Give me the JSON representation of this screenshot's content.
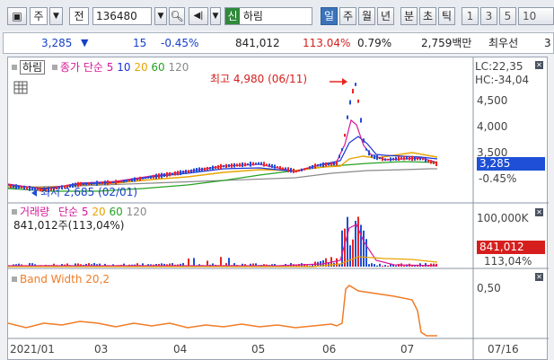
{
  "toolbar": {
    "market": "주",
    "prefix": "전",
    "code": "136480",
    "tag": "신",
    "name": "하림",
    "periods": [
      "일",
      "주",
      "월",
      "년",
      "분",
      "초",
      "틱"
    ],
    "active_period": "일",
    "intervals": [
      "1",
      "3",
      "5",
      "10"
    ]
  },
  "quote": {
    "price": "3,285",
    "change": "15",
    "change_pct": "-0.45%",
    "volume": "841,012",
    "volume_ratio": "113.04%",
    "turnover": "0.79%",
    "amount": "2,759백만",
    "priority": "최우선",
    "priority_val": "3"
  },
  "price_panel": {
    "title": "하림",
    "ma_label": "종가 단순",
    "ma_periods": [
      "5",
      "10",
      "20",
      "60",
      "120"
    ],
    "lc": "LC:22,35",
    "hc": "HC:-34,04",
    "high_note": "최고 4,980 (06/11)",
    "low_note": "최저 2,685 (02/01)",
    "y_ticks": [
      "4,500",
      "4,000",
      "3,500"
    ],
    "current_price": "3,285",
    "current_pct": "-0.45%"
  },
  "volume_panel": {
    "title": "거래량",
    "ma_label": "단순",
    "ma_periods": [
      "5",
      "20",
      "60",
      "120"
    ],
    "volume_text": "841,012주(113,04%)",
    "y_tick": "100,000K",
    "current_volume": "841,012",
    "current_ratio": "113,04%"
  },
  "band_panel": {
    "title": "Band Width 20,2",
    "y_tick": "0,50"
  },
  "x_axis": {
    "labels": [
      "2021/01",
      "03",
      "04",
      "05",
      "06",
      "07"
    ],
    "end_label": "07/16"
  },
  "colors": {
    "ma5": "#d6199a",
    "ma10": "#1e33d6",
    "ma20": "#e8a400",
    "ma60": "#26a226",
    "ma120": "#8a8a8a",
    "band": "#f07c28",
    "up": "#e8261e",
    "down": "#1e4fd6",
    "accent": "#3b73b9"
  },
  "chart_data": {
    "type": "line",
    "x": [
      "2021/01",
      "03",
      "04",
      "05",
      "06",
      "07",
      "07/16"
    ],
    "high": {
      "value": 4980,
      "date": "06/11"
    },
    "low": {
      "value": 2685,
      "date": "02/01"
    },
    "last_price": 3285,
    "last_change_pct": -0.45,
    "last_volume": 841012
  }
}
